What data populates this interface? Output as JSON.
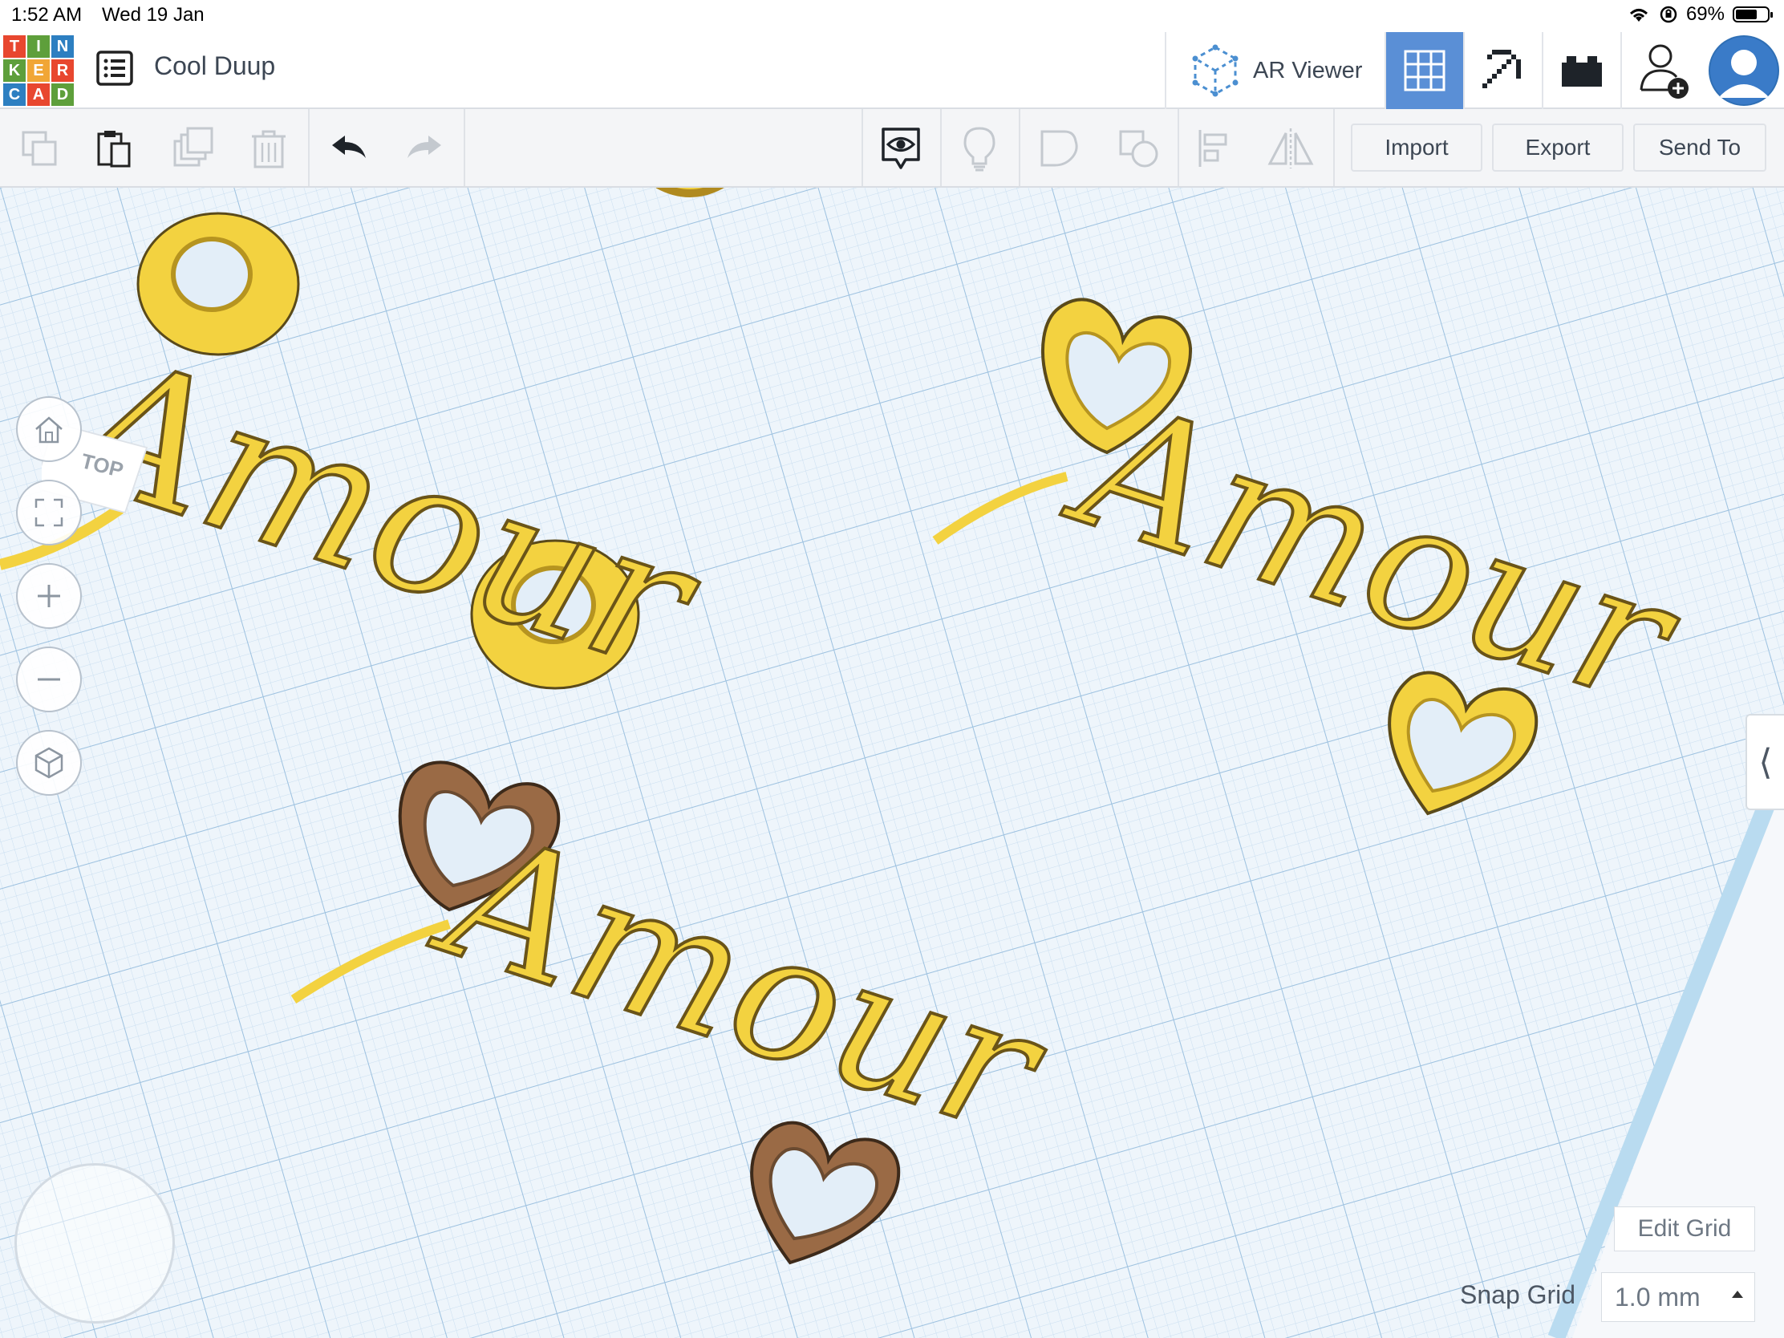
{
  "status_bar": {
    "time": "1:52 AM",
    "date": "Wed 19 Jan",
    "battery": "69%"
  },
  "header": {
    "logo_letters": [
      "T",
      "I",
      "N",
      "K",
      "E",
      "R",
      "C",
      "A",
      "D"
    ],
    "logo_colors": [
      "#e8472f",
      "#5e9f3b",
      "#2d7fc1",
      "#5e9f3b",
      "#f1a636",
      "#e8472f",
      "#2d7fc1",
      "#e8472f",
      "#5e9f3b"
    ],
    "design_title": "Cool Duup",
    "ar_viewer_label": "AR Viewer",
    "active_view": "3d-design-grid"
  },
  "toolbar": {
    "import_label": "Import",
    "export_label": "Export",
    "send_to_label": "Send To"
  },
  "workplane": {
    "view_cube_label": "TOP",
    "edit_grid_label": "Edit Grid",
    "snap_grid_label": "Snap Grid",
    "snap_grid_value": "1.0 mm",
    "objects": [
      {
        "text": "Amour",
        "decoration": "rings",
        "color": "#f3d240"
      },
      {
        "text": "Amour",
        "decoration": "hearts",
        "color": "#f3d240"
      },
      {
        "text": "Amour",
        "decoration": "hearts",
        "color": "#f3d240",
        "heart_color": "#9a6a45"
      }
    ]
  },
  "colors": {
    "accent_blue": "#5a8fd6",
    "grid_bg": "#e7f1f9",
    "grid_line": "#b9d3e8"
  }
}
